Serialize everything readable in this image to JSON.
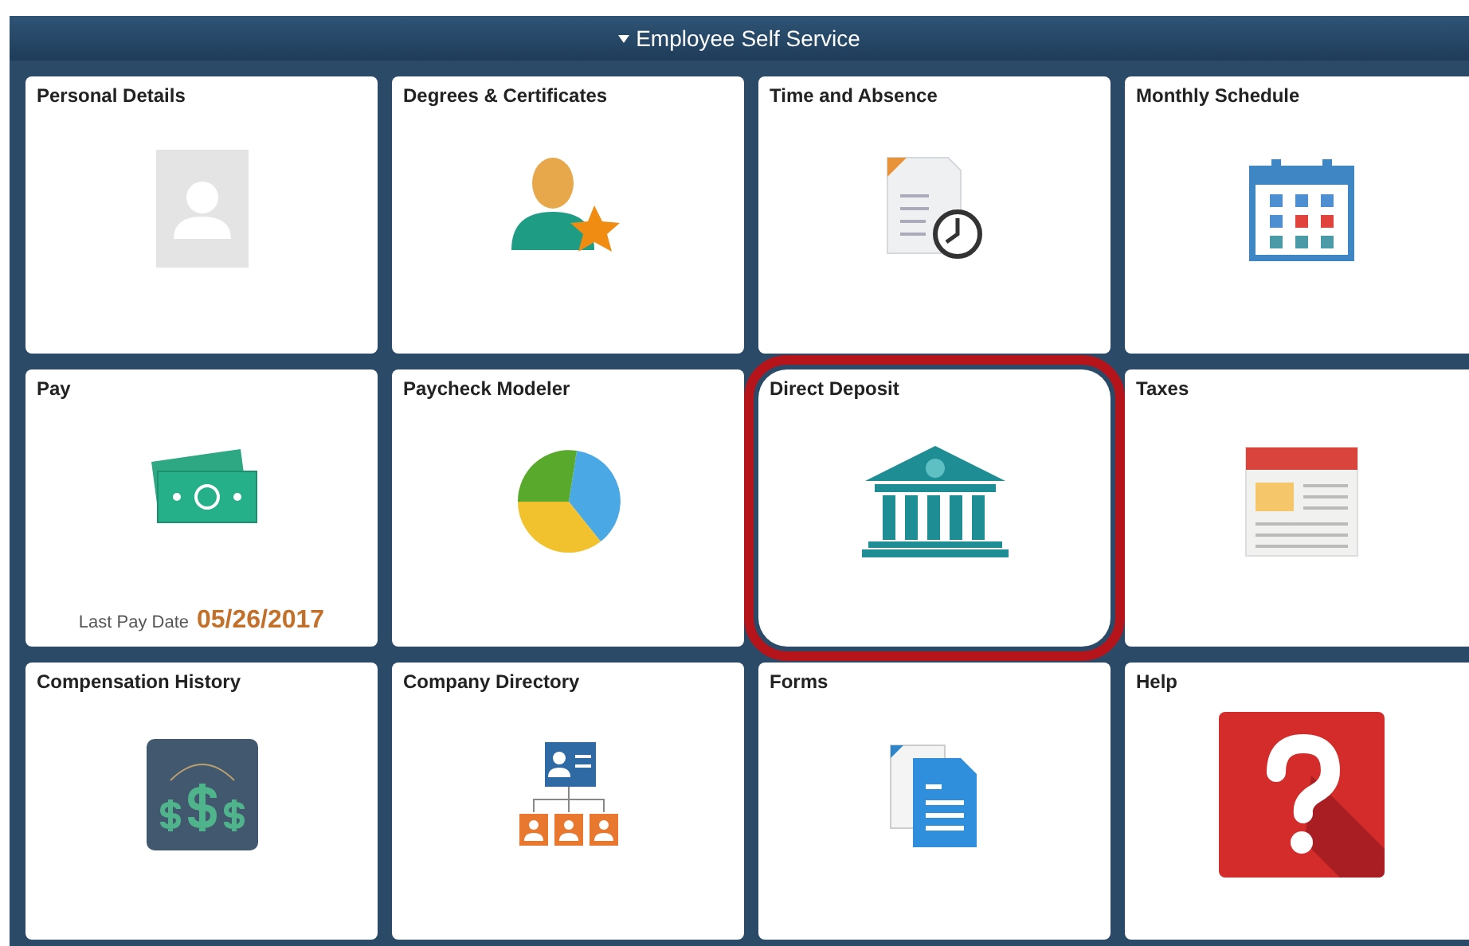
{
  "header": {
    "title": "Employee Self Service"
  },
  "tiles": [
    {
      "title": "Personal Details",
      "kind": "person",
      "highlighted": false
    },
    {
      "title": "Degrees & Certificates",
      "kind": "degree",
      "highlighted": false
    },
    {
      "title": "Time and Absence",
      "kind": "timesheet",
      "highlighted": false
    },
    {
      "title": "Monthly Schedule",
      "kind": "calendar",
      "highlighted": false
    },
    {
      "title": "Pay",
      "kind": "money",
      "highlighted": false,
      "footer_label": "Last Pay Date",
      "footer_value": "05/26/2017"
    },
    {
      "title": "Paycheck Modeler",
      "kind": "pie",
      "highlighted": false
    },
    {
      "title": "Direct Deposit",
      "kind": "bank",
      "highlighted": true
    },
    {
      "title": "Taxes",
      "kind": "taxes",
      "highlighted": false
    },
    {
      "title": "Compensation History",
      "kind": "dollars",
      "highlighted": false
    },
    {
      "title": "Company Directory",
      "kind": "orgchart",
      "highlighted": false
    },
    {
      "title": "Forms",
      "kind": "forms",
      "highlighted": false
    },
    {
      "title": "Help",
      "kind": "help",
      "highlighted": false
    }
  ]
}
